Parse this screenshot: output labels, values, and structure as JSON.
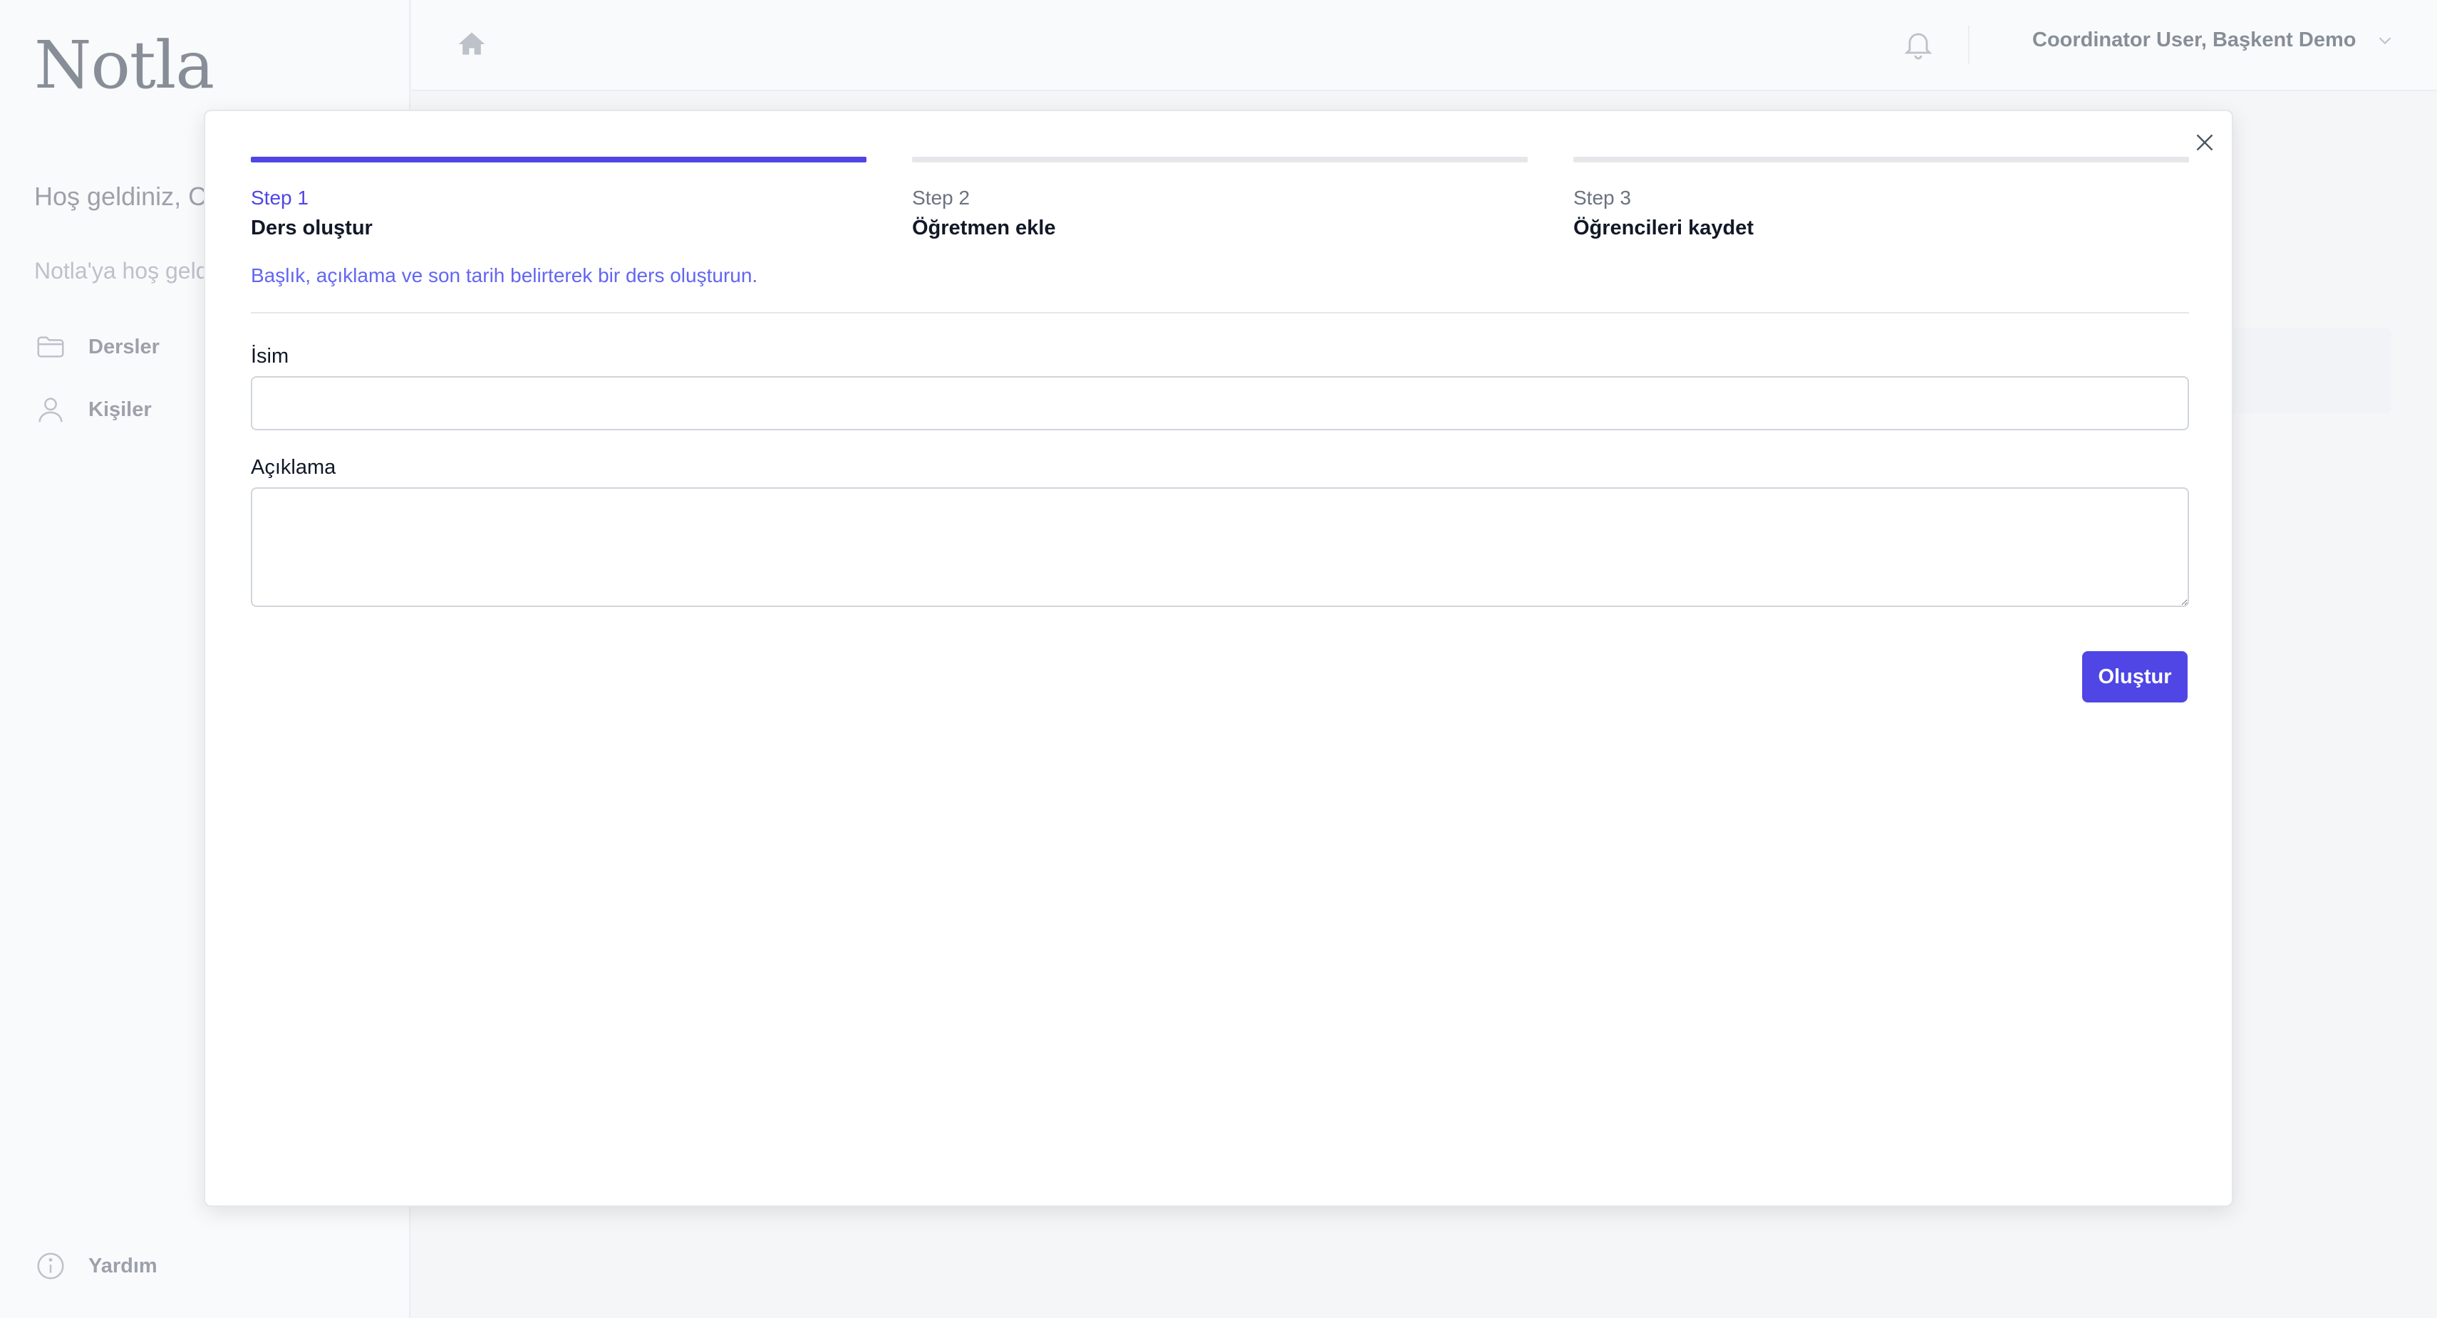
{
  "app": {
    "logo": "Notla"
  },
  "sidebar": {
    "welcome": "Hoş geldiniz, C User!",
    "welcome_sub": "Notla'ya hoş geld",
    "items": [
      {
        "label": "Dersler",
        "icon": "folder-icon"
      },
      {
        "label": "Kişiler",
        "icon": "user-icon"
      }
    ],
    "help": {
      "label": "Yardım",
      "icon": "info-icon"
    }
  },
  "header": {
    "home_icon": "home-icon",
    "bell_icon": "bell-icon",
    "user_label": "Coordinator User, Başkent Demo",
    "chevron_icon": "chevron-down-icon"
  },
  "modal": {
    "close_icon": "close-icon",
    "steps": [
      {
        "number": "Step 1",
        "title": "Ders oluştur",
        "description": "Başlık, açıklama ve son tarih belirterek bir ders oluşturun.",
        "active": true
      },
      {
        "number": "Step 2",
        "title": "Öğretmen ekle",
        "active": false
      },
      {
        "number": "Step 3",
        "title": "Öğrencileri kaydet",
        "active": false
      }
    ],
    "form": {
      "name_label": "İsim",
      "name_value": "",
      "description_label": "Açıklama",
      "description_value": "",
      "submit_label": "Oluştur"
    }
  },
  "colors": {
    "accent": "#4f46e5",
    "accent_text": "#6366f1",
    "background": "#f3f4f6",
    "border": "#e5e7eb"
  }
}
